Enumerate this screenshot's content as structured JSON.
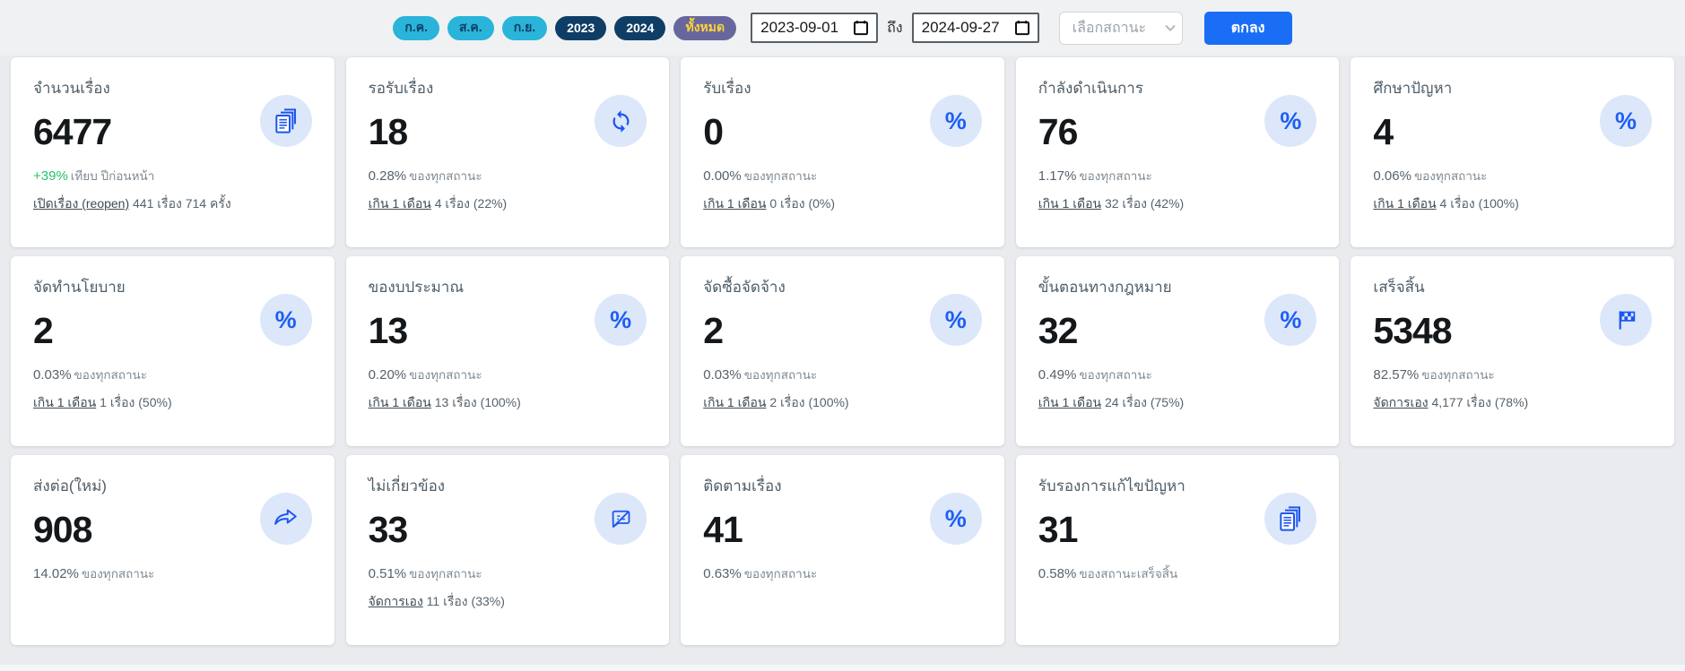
{
  "colors": {
    "accent_blue": "#1a6ef5",
    "icon_blue": "#1d56f0",
    "icon_circle_bg": "#dce7fa",
    "positive_green": "#27c26c",
    "chip_month_bg": "#2ab4d9",
    "chip_year_bg": "#0e3e66",
    "chip_all_bg": "#67679d",
    "chip_all_text": "#ffd337"
  },
  "topbar": {
    "chips": [
      {
        "label": "ก.ค.",
        "type": "month"
      },
      {
        "label": "ส.ค.",
        "type": "month"
      },
      {
        "label": "ก.ย.",
        "type": "month"
      },
      {
        "label": "2023",
        "type": "year"
      },
      {
        "label": "2024",
        "type": "year"
      },
      {
        "label": "ทั้งหมด",
        "type": "all"
      }
    ],
    "date_from": "2023-09-01",
    "date_separator": "ถึง",
    "date_to": "2024-09-27",
    "status_placeholder": "เลือกสถานะ",
    "submit_label": "ตกลง"
  },
  "icons": {
    "percent_glyph": "%"
  },
  "cards": [
    {
      "title": "จำนวนเรื่อง",
      "value": "6477",
      "pct": "+39%",
      "pct_label": "เทียบ ปีก่อนหน้า",
      "link": "เปิดเรื่อง (reopen)",
      "link_detail": "441 เรื่อง 714 ครั้ง",
      "icon": "documents"
    },
    {
      "title": "รอรับเรื่อง",
      "value": "18",
      "pct": "0.28%",
      "pct_label": "ของทุกสถานะ",
      "link": "เกิน 1 เดือน",
      "link_detail": "4 เรื่อง (22%)",
      "icon": "refresh"
    },
    {
      "title": "รับเรื่อง",
      "value": "0",
      "pct": "0.00%",
      "pct_label": "ของทุกสถานะ",
      "link": "เกิน 1 เดือน",
      "link_detail": "0 เรื่อง (0%)",
      "icon": "percent"
    },
    {
      "title": "กำลังดำเนินการ",
      "value": "76",
      "pct": "1.17%",
      "pct_label": "ของทุกสถานะ",
      "link": "เกิน 1 เดือน",
      "link_detail": "32 เรื่อง (42%)",
      "icon": "percent"
    },
    {
      "title": "ศึกษาปัญหา",
      "value": "4",
      "pct": "0.06%",
      "pct_label": "ของทุกสถานะ",
      "link": "เกิน 1 เดือน",
      "link_detail": "4 เรื่อง (100%)",
      "icon": "percent"
    },
    {
      "title": "จัดทำนโยบาย",
      "value": "2",
      "pct": "0.03%",
      "pct_label": "ของทุกสถานะ",
      "link": "เกิน 1 เดือน",
      "link_detail": "1 เรื่อง (50%)",
      "icon": "percent"
    },
    {
      "title": "ของบประมาณ",
      "value": "13",
      "pct": "0.20%",
      "pct_label": "ของทุกสถานะ",
      "link": "เกิน 1 เดือน",
      "link_detail": "13 เรื่อง (100%)",
      "icon": "percent"
    },
    {
      "title": "จัดซื้อจัดจ้าง",
      "value": "2",
      "pct": "0.03%",
      "pct_label": "ของทุกสถานะ",
      "link": "เกิน 1 เดือน",
      "link_detail": "2 เรื่อง (100%)",
      "icon": "percent"
    },
    {
      "title": "ขั้นตอนทางกฎหมาย",
      "value": "32",
      "pct": "0.49%",
      "pct_label": "ของทุกสถานะ",
      "link": "เกิน 1 เดือน",
      "link_detail": "24 เรื่อง (75%)",
      "icon": "percent"
    },
    {
      "title": "เสร็จสิ้น",
      "value": "5348",
      "pct": "82.57%",
      "pct_label": "ของทุกสถานะ",
      "link": "จัดการเอง",
      "link_detail": "4,177 เรื่อง (78%)",
      "icon": "flag"
    },
    {
      "title": "ส่งต่อ(ใหม่)",
      "value": "908",
      "pct": "14.02%",
      "pct_label": "ของทุกสถานะ",
      "icon": "share"
    },
    {
      "title": "ไม่เกี่ยวข้อง",
      "value": "33",
      "pct": "0.51%",
      "pct_label": "ของทุกสถานะ",
      "link": "จัดการเอง",
      "link_detail": "11 เรื่อง (33%)",
      "icon": "no-chat"
    },
    {
      "title": "ติดตามเรื่อง",
      "value": "41",
      "pct": "0.63%",
      "pct_label": "ของทุกสถานะ",
      "icon": "percent"
    },
    {
      "title": "รับรองการแก้ไขปัญหา",
      "value": "31",
      "pct": "0.58%",
      "pct_label": "ของสถานะเสร็จสิ้น",
      "icon": "documents"
    }
  ]
}
